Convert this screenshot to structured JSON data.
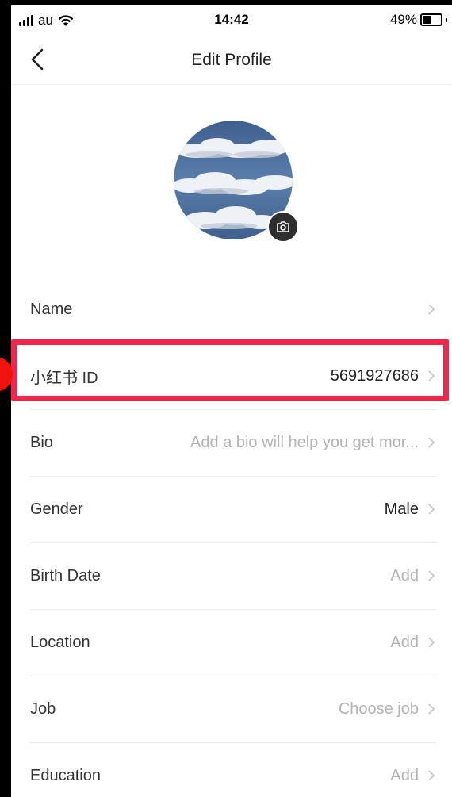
{
  "status_bar": {
    "carrier": "au",
    "time": "14:42",
    "battery": "49%",
    "battery_level": 0.49
  },
  "header": {
    "title": "Edit Profile",
    "back_icon": "chevron-left-icon"
  },
  "avatar": {
    "camera_icon": "camera-icon"
  },
  "rows": [
    {
      "label": "Name",
      "value": ""
    },
    {
      "label": "小红书 ID",
      "value": "5691927686"
    },
    {
      "label": "Bio",
      "value": "Add a bio will help you get mor..."
    },
    {
      "label": "Gender",
      "value": "Male"
    },
    {
      "label": "Birth Date",
      "value": "Add"
    },
    {
      "label": "Location",
      "value": "Add"
    },
    {
      "label": "Job",
      "value": "Choose job"
    },
    {
      "label": "Education",
      "value": "Add"
    }
  ],
  "colors": {
    "highlight": "#f0264a",
    "value_gray": "#b3b3b3",
    "text_dark": "#222222"
  }
}
